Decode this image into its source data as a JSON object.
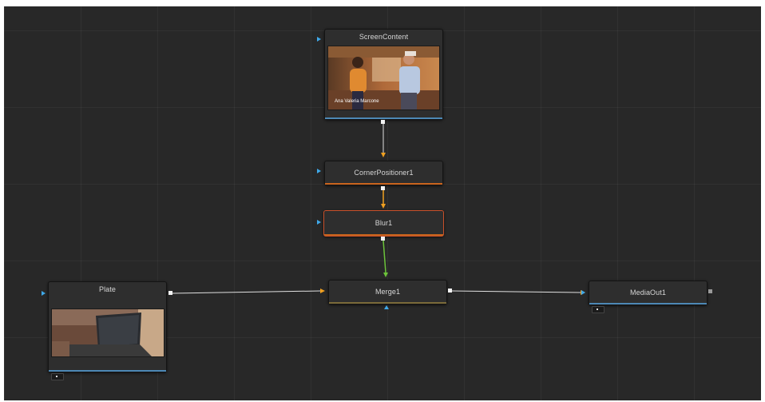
{
  "nodes": {
    "screen_content": {
      "title": "ScreenContent",
      "thumbnail_caption": "Ana Valeria Marcone"
    },
    "corner_positioner": {
      "title": "CornerPositioner1"
    },
    "blur": {
      "title": "Blur1",
      "selected": true
    },
    "merge": {
      "title": "Merge1"
    },
    "plate": {
      "title": "Plate"
    },
    "media_out": {
      "title": "MediaOut1"
    }
  },
  "connections": [
    {
      "from": "ScreenContent",
      "to": "CornerPositioner1",
      "color": "#e0e0e0"
    },
    {
      "from": "CornerPositioner1",
      "to": "Blur1",
      "color": "#f0a020"
    },
    {
      "from": "Blur1",
      "to": "Merge1",
      "color": "#6cc43a"
    },
    {
      "from": "Plate",
      "to": "Merge1",
      "color": "#e0e0e0"
    },
    {
      "from": "Merge1",
      "to": "MediaOut1",
      "color": "#e0e0e0"
    }
  ],
  "colors": {
    "canvas_bg": "#282828",
    "node_bg": "#2e2e2e",
    "input_triangle": "#3fa8e8",
    "image_node_bar": "#4d88b5",
    "effect_node_bar": "#c8641e",
    "selected_border": "#c8502a"
  }
}
